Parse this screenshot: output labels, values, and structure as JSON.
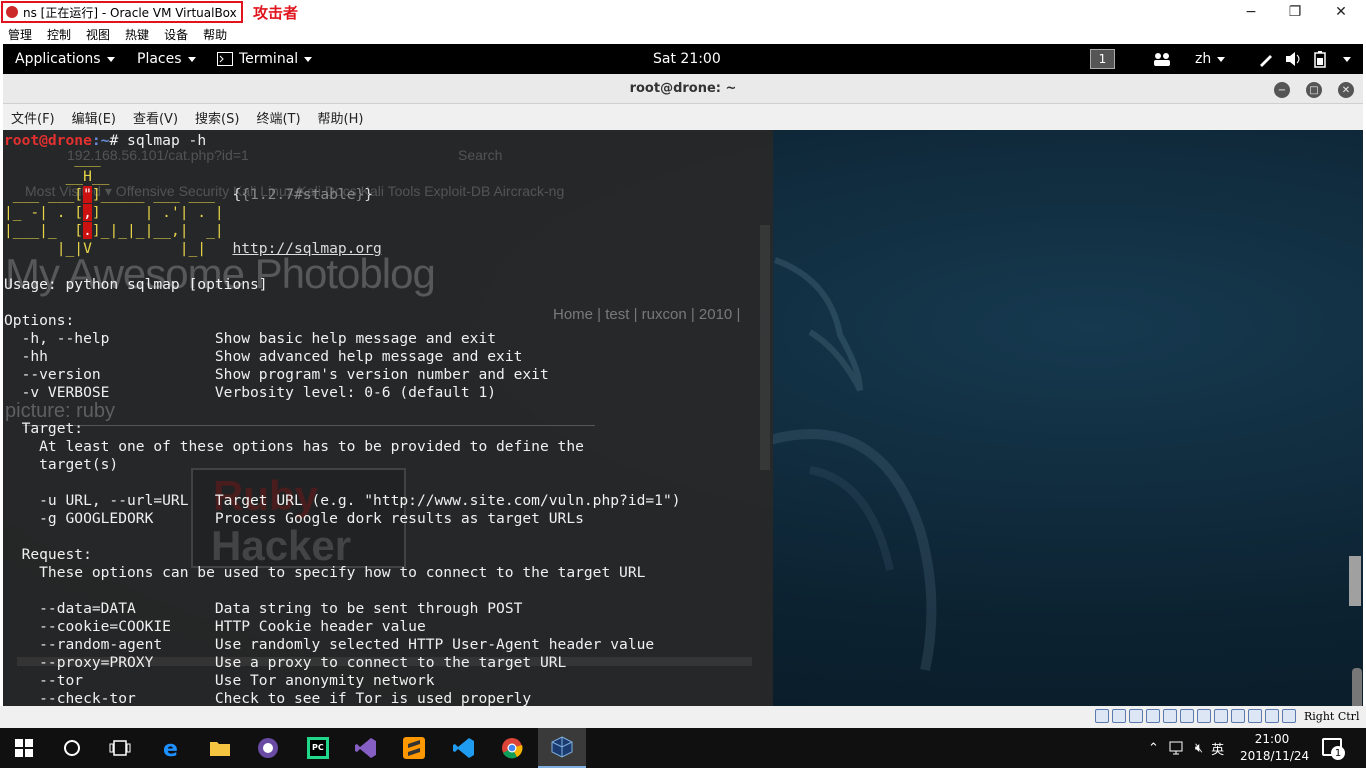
{
  "vbox": {
    "title": "ns [正在运行] - Oracle VM VirtualBox",
    "attacker_label": "攻击者",
    "minimize": "−",
    "restore": "❐",
    "close": "✕",
    "menu": [
      "管理",
      "控制",
      "视图",
      "热键",
      "设备",
      "帮助"
    ],
    "host_key": "Right Ctrl"
  },
  "gnome": {
    "applications": "Applications",
    "places": "Places",
    "terminal": "Terminal",
    "clock": "Sat 21:00",
    "workspace": "1",
    "input_method": "zh"
  },
  "terminal": {
    "title": "root@drone: ~",
    "menu": [
      "文件(F)",
      "编辑(E)",
      "查看(V)",
      "搜索(S)",
      "终端(T)",
      "帮助(H)"
    ],
    "prompt_user": "root@drone",
    "prompt_path": ":~",
    "prompt_symbol": "# ",
    "command": "sqlmap -h",
    "logo": {
      "l1": "        ___",
      "l2": "       __H__",
      "l3a": " ___ ___[",
      "l3b": "\"",
      "l3c": "]_____ ___ ___  ",
      "version": "{1.2.7#stable}",
      "l4a": "|_ -| . [",
      "l4b": ",",
      "l4c": "]     | .'| . |",
      "l5a": "|___|_  [",
      "l5b": ".",
      "l5c": "]_|_|_|__,|  _|",
      "l6a": "      |_|V          |_|   ",
      "url": "http://sqlmap.org"
    },
    "usage": "Usage: python sqlmap [options]",
    "options_header": "Options:",
    "options": [
      {
        "flag": "  -h, --help            ",
        "desc": "Show basic help message and exit"
      },
      {
        "flag": "  -hh                   ",
        "desc": "Show advanced help message and exit"
      },
      {
        "flag": "  --version             ",
        "desc": "Show program's version number and exit"
      },
      {
        "flag": "  -v VERBOSE            ",
        "desc": "Verbosity level: 0-6 (default 1)"
      }
    ],
    "target_header": "  Target:",
    "target_desc1": "    At least one of these options has to be provided to define the",
    "target_desc2": "    target(s)",
    "target_opts": [
      {
        "flag": "    -u URL, --url=URL   ",
        "desc": "Target URL (e.g. \"http://www.site.com/vuln.php?id=1\")"
      },
      {
        "flag": "    -g GOOGLEDORK       ",
        "desc": "Process Google dork results as target URLs"
      }
    ],
    "request_header": "  Request:",
    "request_desc": "    These options can be used to specify how to connect to the target URL",
    "request_opts": [
      {
        "flag": "    --data=DATA         ",
        "desc": "Data string to be sent through POST"
      },
      {
        "flag": "    --cookie=COOKIE     ",
        "desc": "HTTP Cookie header value"
      },
      {
        "flag": "    --random-agent      ",
        "desc": "Use randomly selected HTTP User-Agent header value"
      },
      {
        "flag": "    --proxy=PROXY       ",
        "desc": "Use a proxy to connect to the target URL"
      },
      {
        "flag": "    --tor               ",
        "desc": "Use Tor anonymity network"
      },
      {
        "flag": "    --check-tor         ",
        "desc": "Check to see if Tor is used properly"
      }
    ]
  },
  "ghost_browser": {
    "url": "192.168.56.101/cat.php?id=1",
    "search": "Search",
    "bookmarks": "Most Visited ▾   Offensive Security   Kali Linux   Kali Docs   Kali Tools   Exploit-DB   Aircrack-ng",
    "heading": "My Awesome Photoblog",
    "nav": "Home | test | ruxcon | 2010 |",
    "picture": "picture: ruby",
    "logo_top": "Ruby",
    "logo_bottom": "Hacker"
  },
  "taskbar": {
    "apps": [
      "start-icon",
      "cortana-icon",
      "task-view-icon",
      "edge-icon",
      "file-explorer-icon",
      "app-purple-icon",
      "pycharm-icon",
      "visual-studio-icon",
      "sublime-icon",
      "vscode-icon",
      "chrome-icon",
      "virtualbox-icon"
    ],
    "time": "21:00",
    "date": "2018/11/24",
    "ime": "英",
    "notifications": "1"
  },
  "colors": {
    "highlight_red": "#e0141c",
    "prompt_red": "#e53030",
    "prompt_blue": "#6b8de0",
    "logo_yellow": "#e7d44a"
  }
}
